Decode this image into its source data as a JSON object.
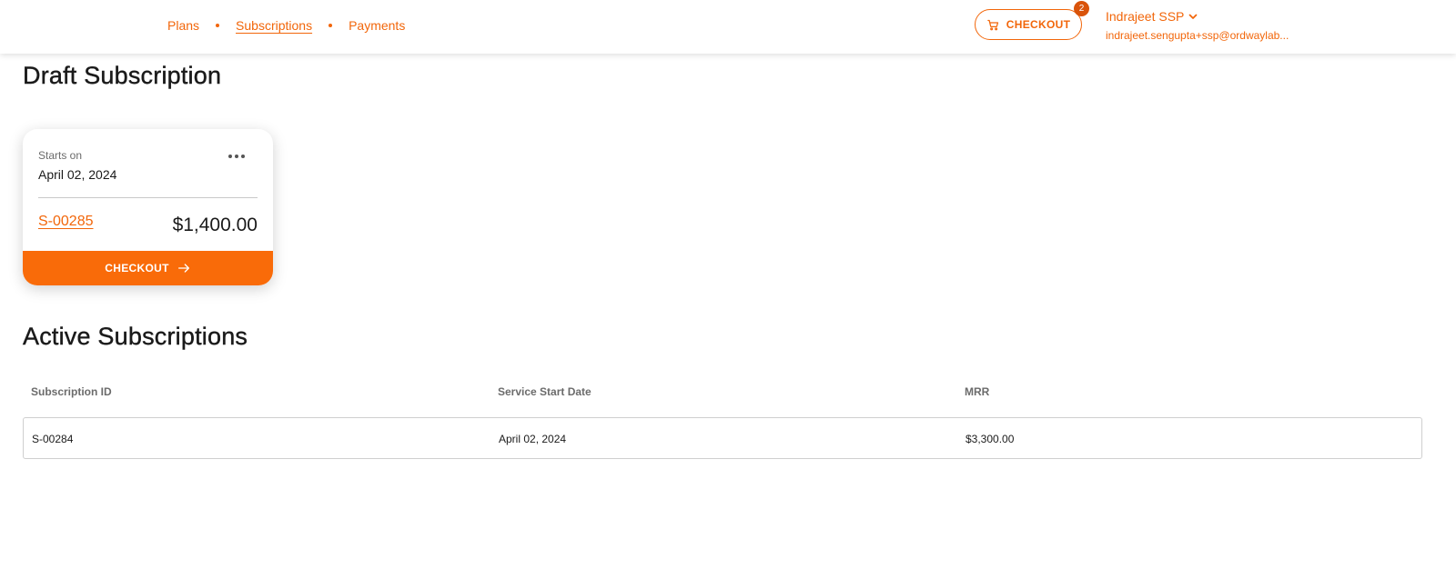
{
  "nav": {
    "items": [
      {
        "label": "Plans"
      },
      {
        "label": "Subscriptions"
      },
      {
        "label": "Payments"
      }
    ]
  },
  "header": {
    "checkout_label": "CHECKOUT",
    "cart_count": "2",
    "user_name": "Indrajeet SSP",
    "user_email": "indrajeet.sengupta+ssp@ordwaylab..."
  },
  "draft": {
    "title": "Draft Subscription",
    "starts_label": "Starts on",
    "starts_date": "April 02, 2024",
    "subscription_id": "S-00285",
    "amount": "$1,400.00",
    "checkout_label": "CHECKOUT"
  },
  "active": {
    "title": "Active Subscriptions",
    "columns": [
      "Subscription ID",
      "Service Start Date",
      "MRR"
    ],
    "rows": [
      [
        "S-00284",
        "April 02, 2024",
        "$3,300.00"
      ]
    ]
  },
  "colors": {
    "accent": "#f2660a",
    "button": "#f96b09",
    "badge": "#d9530a"
  },
  "icons": [
    "cart-icon",
    "chevron-down-icon",
    "more-icon",
    "arrow-right-icon"
  ]
}
